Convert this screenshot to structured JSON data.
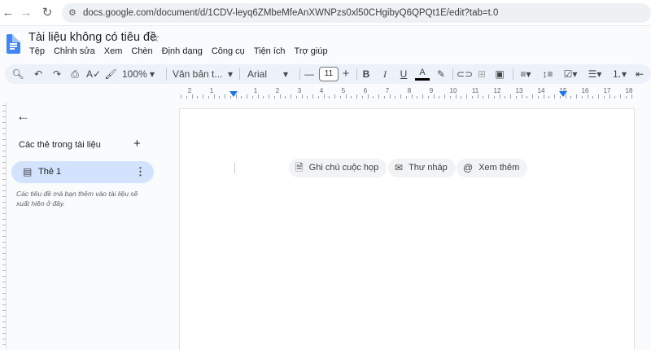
{
  "browser": {
    "url": "docs.google.com/document/d/1CDV-leyq6ZMbeMfeAnXWNPzs0xl50CHgibyQ6QPQt1E/edit?tab=t.0"
  },
  "doc": {
    "title": "Tài liệu không có tiêu đề"
  },
  "menu": [
    "Tệp",
    "Chỉnh sửa",
    "Xem",
    "Chèn",
    "Định dạng",
    "Công cụ",
    "Tiện ích",
    "Trợ giúp"
  ],
  "toolbar": {
    "zoom": "100%",
    "style": "Văn bản t...",
    "font": "Arial",
    "font_size": "11"
  },
  "ruler": {
    "left": [
      "2",
      "1"
    ],
    "right": [
      "1",
      "2",
      "3",
      "4",
      "5",
      "6",
      "7",
      "8",
      "9",
      "10",
      "11",
      "12",
      "13",
      "14",
      "15",
      "16",
      "17",
      "18"
    ]
  },
  "sidebar": {
    "heading": "Các thẻ trong tài liệu",
    "tab_label": "Thẻ 1",
    "hint": "Các tiêu đề mà bạn thêm vào tài liệu sẽ xuất hiện ở đây."
  },
  "chips": [
    "Ghi chú cuộc họp",
    "Thư nháp",
    "Xem thêm"
  ],
  "colors": {
    "accent": "#1a73e8",
    "selected_tab": "#d3e3fd",
    "toolbar": "#edf2fa"
  }
}
